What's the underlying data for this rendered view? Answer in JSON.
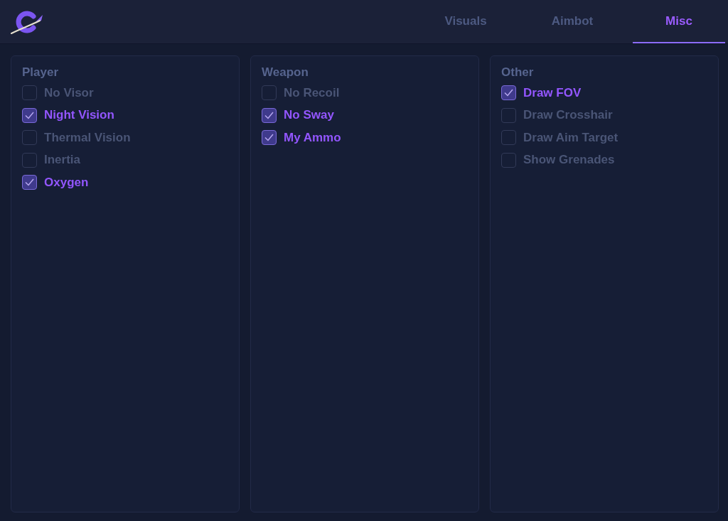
{
  "header": {
    "tabs": [
      {
        "label": "Visuals",
        "selected": false
      },
      {
        "label": "Aimbot",
        "selected": false
      },
      {
        "label": "Misc",
        "selected": true
      }
    ]
  },
  "panels": [
    {
      "title": "Player",
      "options": [
        {
          "label": "No Visor",
          "checked": false
        },
        {
          "label": "Night Vision",
          "checked": true
        },
        {
          "label": "Thermal Vision",
          "checked": false
        },
        {
          "label": "Inertia",
          "checked": false
        },
        {
          "label": "Oxygen",
          "checked": true
        }
      ]
    },
    {
      "title": "Weapon",
      "options": [
        {
          "label": "No Recoil",
          "checked": false
        },
        {
          "label": "No Sway",
          "checked": true
        },
        {
          "label": "My Ammo",
          "checked": true
        }
      ]
    },
    {
      "title": "Other",
      "options": [
        {
          "label": "Draw FOV",
          "checked": true
        },
        {
          "label": "Draw Crosshair",
          "checked": false
        },
        {
          "label": "Draw Aim Target",
          "checked": false
        },
        {
          "label": "Show Grenades",
          "checked": false
        }
      ]
    }
  ]
}
